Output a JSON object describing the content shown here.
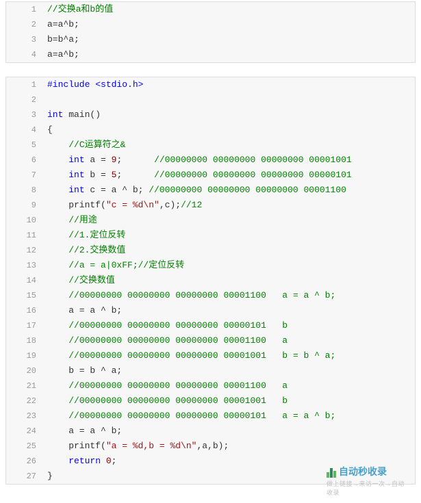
{
  "blocks": [
    {
      "lines": [
        {
          "n": 1,
          "tokens": [
            {
              "t": "//交换a和b的值",
              "c": "tok-comment"
            }
          ]
        },
        {
          "n": 2,
          "tokens": [
            {
              "t": "a=a^b;"
            }
          ]
        },
        {
          "n": 3,
          "tokens": [
            {
              "t": "b=b^a;"
            }
          ]
        },
        {
          "n": 4,
          "tokens": [
            {
              "t": "a=a^b;"
            }
          ]
        }
      ]
    },
    {
      "lines": [
        {
          "n": 1,
          "tokens": [
            {
              "t": "#include <stdio.h>",
              "c": "tok-include"
            }
          ]
        },
        {
          "n": 2,
          "tokens": [
            {
              "t": ""
            }
          ]
        },
        {
          "n": 3,
          "tokens": [
            {
              "t": "int",
              "c": "tok-keyword"
            },
            {
              "t": " main()"
            }
          ]
        },
        {
          "n": 4,
          "tokens": [
            {
              "t": "{"
            }
          ]
        },
        {
          "n": 5,
          "tokens": [
            {
              "t": "    "
            },
            {
              "t": "//C运算符之&",
              "c": "tok-comment"
            }
          ]
        },
        {
          "n": 6,
          "tokens": [
            {
              "t": "    "
            },
            {
              "t": "int",
              "c": "tok-keyword"
            },
            {
              "t": " a = "
            },
            {
              "t": "9",
              "c": "tok-number"
            },
            {
              "t": ";      "
            },
            {
              "t": "//00000000 00000000 00000000 00001001",
              "c": "tok-comment"
            }
          ]
        },
        {
          "n": 7,
          "tokens": [
            {
              "t": "    "
            },
            {
              "t": "int",
              "c": "tok-keyword"
            },
            {
              "t": " b = "
            },
            {
              "t": "5",
              "c": "tok-number"
            },
            {
              "t": ";      "
            },
            {
              "t": "//00000000 00000000 00000000 00000101",
              "c": "tok-comment"
            }
          ]
        },
        {
          "n": 8,
          "tokens": [
            {
              "t": "    "
            },
            {
              "t": "int",
              "c": "tok-keyword"
            },
            {
              "t": " c = a ^ b; "
            },
            {
              "t": "//00000000 00000000 00000000 00001100",
              "c": "tok-comment"
            }
          ]
        },
        {
          "n": 9,
          "tokens": [
            {
              "t": "    printf("
            },
            {
              "t": "\"c = %d\\n\"",
              "c": "tok-string"
            },
            {
              "t": ",c);"
            },
            {
              "t": "//12",
              "c": "tok-comment"
            }
          ]
        },
        {
          "n": 10,
          "tokens": [
            {
              "t": "    "
            },
            {
              "t": "//用途",
              "c": "tok-comment"
            }
          ]
        },
        {
          "n": 11,
          "tokens": [
            {
              "t": "    "
            },
            {
              "t": "//1.定位反转",
              "c": "tok-comment"
            }
          ]
        },
        {
          "n": 12,
          "tokens": [
            {
              "t": "    "
            },
            {
              "t": "//2.交换数值",
              "c": "tok-comment"
            }
          ]
        },
        {
          "n": 13,
          "tokens": [
            {
              "t": "    "
            },
            {
              "t": "//a = a|0xFF;//定位反转",
              "c": "tok-comment"
            }
          ]
        },
        {
          "n": 14,
          "tokens": [
            {
              "t": "    "
            },
            {
              "t": "//交换数值",
              "c": "tok-comment"
            }
          ]
        },
        {
          "n": 15,
          "tokens": [
            {
              "t": "    "
            },
            {
              "t": "//00000000 00000000 00000000 00001100   a = a ^ b;",
              "c": "tok-comment"
            }
          ]
        },
        {
          "n": 16,
          "tokens": [
            {
              "t": "    a = a ^ b;"
            }
          ]
        },
        {
          "n": 17,
          "tokens": [
            {
              "t": "    "
            },
            {
              "t": "//00000000 00000000 00000000 00000101   b",
              "c": "tok-comment"
            }
          ]
        },
        {
          "n": 18,
          "tokens": [
            {
              "t": "    "
            },
            {
              "t": "//00000000 00000000 00000000 00001100   a",
              "c": "tok-comment"
            }
          ]
        },
        {
          "n": 19,
          "tokens": [
            {
              "t": "    "
            },
            {
              "t": "//00000000 00000000 00000000 00001001   b = b ^ a;",
              "c": "tok-comment"
            }
          ]
        },
        {
          "n": 20,
          "tokens": [
            {
              "t": "    b = b ^ a;"
            }
          ]
        },
        {
          "n": 21,
          "tokens": [
            {
              "t": "    "
            },
            {
              "t": "//00000000 00000000 00000000 00001100   a",
              "c": "tok-comment"
            }
          ]
        },
        {
          "n": 22,
          "tokens": [
            {
              "t": "    "
            },
            {
              "t": "//00000000 00000000 00000000 00001001   b",
              "c": "tok-comment"
            }
          ]
        },
        {
          "n": 23,
          "tokens": [
            {
              "t": "    "
            },
            {
              "t": "//00000000 00000000 00000000 00000101   a = a ^ b;",
              "c": "tok-comment"
            }
          ]
        },
        {
          "n": 24,
          "tokens": [
            {
              "t": "    a = a ^ b;"
            }
          ]
        },
        {
          "n": 25,
          "tokens": [
            {
              "t": "    printf("
            },
            {
              "t": "\"a = %d,b = %d\\n\"",
              "c": "tok-string"
            },
            {
              "t": ",a,b);"
            }
          ]
        },
        {
          "n": 26,
          "tokens": [
            {
              "t": "    "
            },
            {
              "t": "return",
              "c": "tok-keyword"
            },
            {
              "t": " "
            },
            {
              "t": "0",
              "c": "tok-number"
            },
            {
              "t": ";"
            }
          ]
        },
        {
          "n": 27,
          "tokens": [
            {
              "t": "}"
            }
          ]
        }
      ]
    }
  ],
  "watermark": {
    "brand": "自动秒收录",
    "subtext": "做上链接→来访一次→自动收录"
  }
}
